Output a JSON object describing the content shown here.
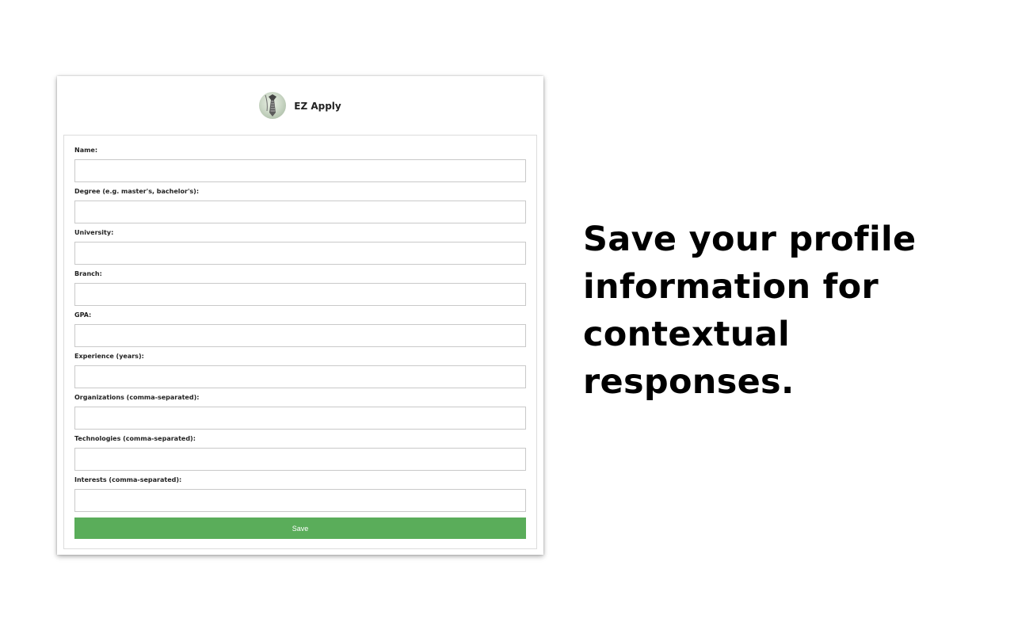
{
  "app": {
    "name": "EZ Apply",
    "logo_icon": "tie-logo-icon"
  },
  "form": {
    "fields": [
      {
        "label": "Name:",
        "value": "",
        "placeholder": ""
      },
      {
        "label": "Degree (e.g. master's, bachelor's):",
        "value": "",
        "placeholder": ""
      },
      {
        "label": "University:",
        "value": "",
        "placeholder": ""
      },
      {
        "label": "Branch:",
        "value": "",
        "placeholder": ""
      },
      {
        "label": "GPA:",
        "value": "",
        "placeholder": ""
      },
      {
        "label": "Experience (years):",
        "value": "",
        "placeholder": ""
      },
      {
        "label": "Organizations (comma-separated):",
        "value": "",
        "placeholder": ""
      },
      {
        "label": "Technologies (comma-separated):",
        "value": "",
        "placeholder": ""
      },
      {
        "label": "Interests (comma-separated):",
        "value": "",
        "placeholder": ""
      }
    ],
    "save_label": "Save"
  },
  "colors": {
    "save_button": "#5aad5a",
    "background": "#ffffff"
  },
  "tagline": "Save your profile information for contextual responses."
}
